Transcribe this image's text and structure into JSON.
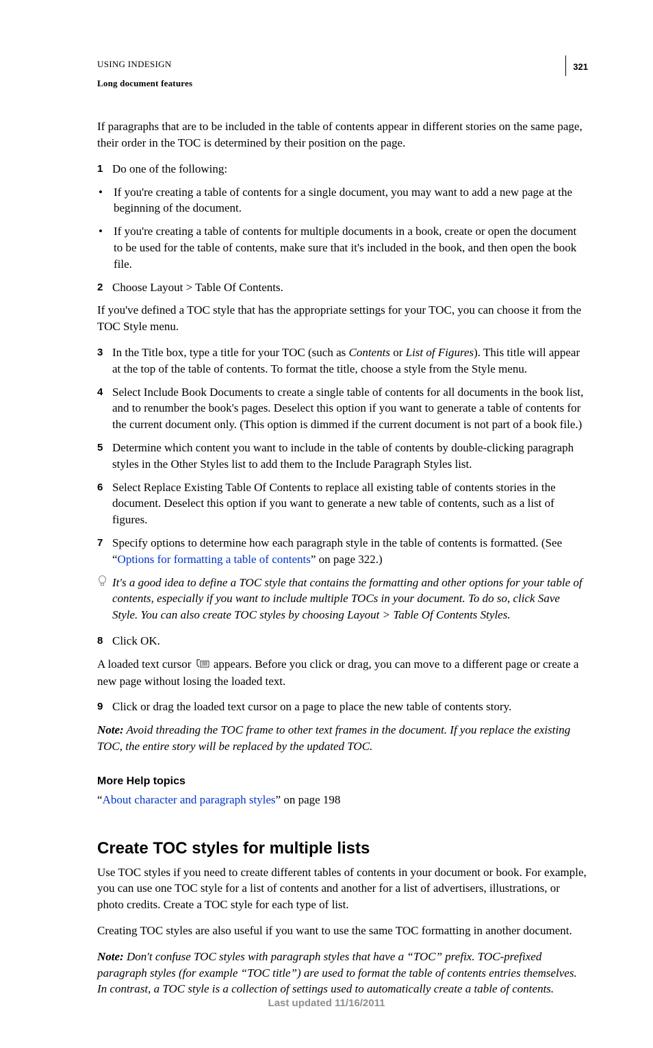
{
  "header": {
    "doc_title": "USING INDESIGN",
    "section": "Long document features",
    "page_number": "321"
  },
  "intro": "If paragraphs that are to be included in the table of contents appear in different stories on the same page, their order in the TOC is determined by their position on the page.",
  "step1": "Do one of the following:",
  "bullet1": "If you're creating a table of contents for a single document, you may want to add a new page at the beginning of the document.",
  "bullet2": "If you're creating a table of contents for multiple documents in a book, create or open the document to be used for the table of contents, make sure that it's included in the book, and then open the book file.",
  "step2": "Choose Layout > Table Of Contents.",
  "after_step2": "If you've defined a TOC style that has the appropriate settings for your TOC, you can choose it from the TOC Style menu.",
  "step3_a": "In the Title box, type a title for your TOC (such as ",
  "step3_it1": "Contents",
  "step3_b": " or ",
  "step3_it2": "List of Figures",
  "step3_c": "). This title will appear at the top of the table of contents. To format the title, choose a style from the Style menu.",
  "step4": "Select Include Book Documents to create a single table of contents for all documents in the book list, and to renumber the book's pages. Deselect this option if you want to generate a table of contents for the current document only. (This option is dimmed if the current document is not part of a book file.)",
  "step5": "Determine which content you want to include in the table of contents by double-clicking paragraph styles in the Other Styles list to add them to the Include Paragraph Styles list.",
  "step6": "Select Replace Existing Table Of Contents to replace all existing table of contents stories in the document. Deselect this option if you want to generate a new table of contents, such as a list of figures.",
  "step7_a": "Specify options to determine how each paragraph style in the table of contents is formatted. (See “",
  "step7_link": "Options for formatting a table of contents",
  "step7_b": "” on page 322.)",
  "tip": "It's a good idea to define a TOC style that contains the formatting and other options for your table of contents, especially if you want to include multiple TOCs in your document. To do so, click Save Style. You can also create TOC styles by choosing Layout > Table Of Contents Styles.",
  "step8": "Click OK.",
  "after_step8_a": "A loaded text cursor ",
  "after_step8_b": " appears. Before you click or drag, you can move to a different page or create a new page without losing the loaded text.",
  "step9": "Click or drag the loaded text cursor on a page to place the new table of contents story.",
  "note1_label": "Note:",
  "note1": " Avoid threading the TOC frame to other text frames in the document. If you replace the existing TOC, the entire story will be replaced by the updated TOC.",
  "more_help_heading": "More Help topics",
  "more_help_q1": "“",
  "more_help_link": "About character and paragraph styles",
  "more_help_q2": "” on page 198",
  "h2": "Create TOC styles for multiple lists",
  "sec2_p1": "Use TOC styles if you need to create different tables of contents in your document or book. For example, you can use one TOC style for a list of contents and another for a list of advertisers, illustrations, or photo credits. Create a TOC style for each type of list.",
  "sec2_p2": "Creating TOC styles are also useful if you want to use the same TOC formatting in another document.",
  "note2_label": "Note:",
  "note2": " Don't confuse TOC styles with paragraph styles that have a “TOC” prefix. TOC-prefixed paragraph styles (for example “TOC title”) are used to format the table of contents entries themselves. In contrast, a TOC style is a collection of settings used to automatically create a table of contents.",
  "footer": "Last updated 11/16/2011"
}
